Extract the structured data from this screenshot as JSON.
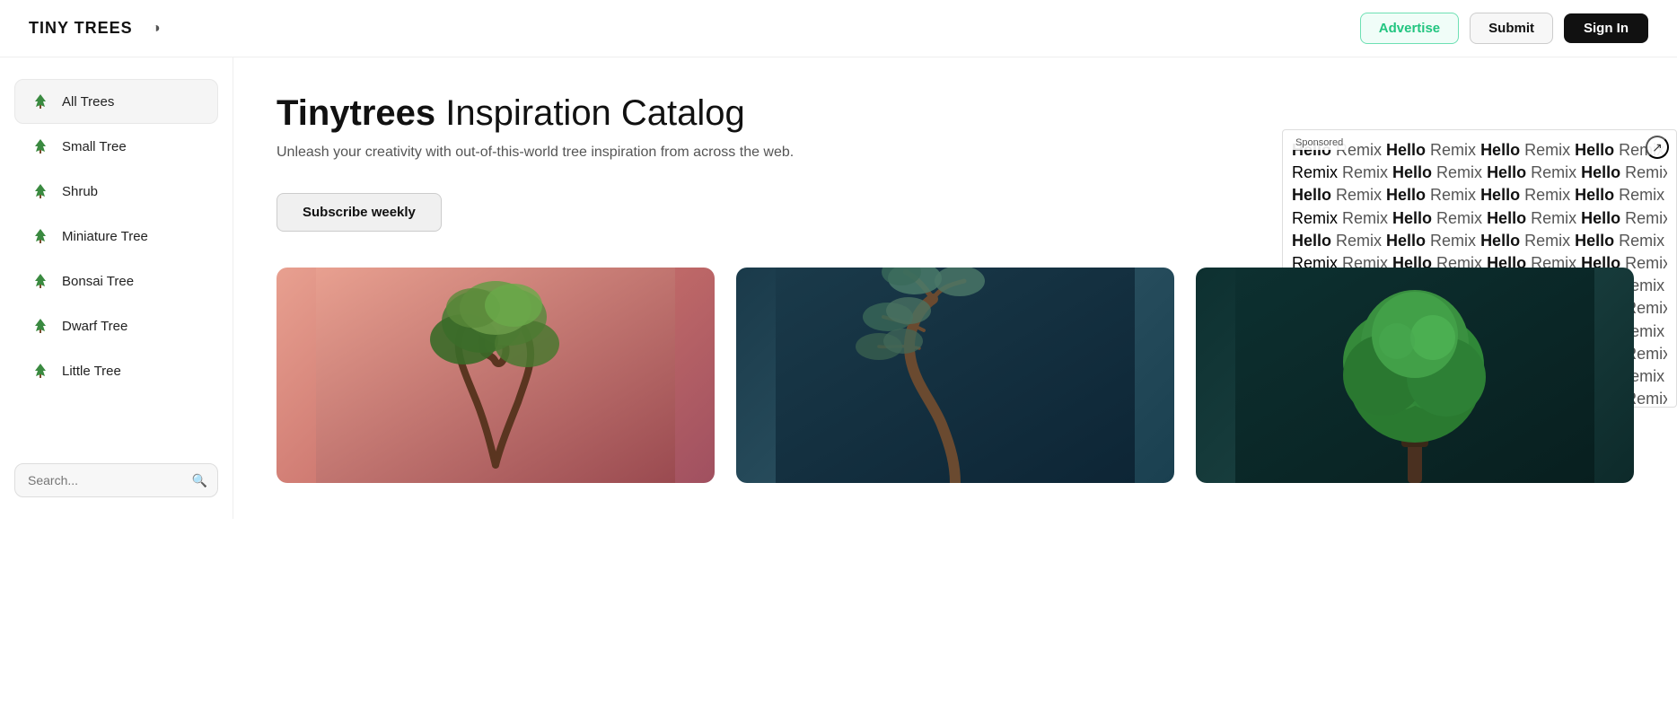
{
  "header": {
    "logo": "TINY TREES",
    "theme_toggle_icon": "◑",
    "advertise_label": "Advertise",
    "submit_label": "Submit",
    "signin_label": "Sign In"
  },
  "sidebar": {
    "items": [
      {
        "id": "all-trees",
        "label": "All Trees",
        "icon": "🌲",
        "active": true
      },
      {
        "id": "small-tree",
        "label": "Small Tree",
        "icon": "🌲",
        "active": false
      },
      {
        "id": "shrub",
        "label": "Shrub",
        "icon": "🌲",
        "active": false
      },
      {
        "id": "miniature-tree",
        "label": "Miniature Tree",
        "icon": "🌲",
        "active": false
      },
      {
        "id": "bonsai-tree",
        "label": "Bonsai Tree",
        "icon": "🌲",
        "active": false
      },
      {
        "id": "dwarf-tree",
        "label": "Dwarf Tree",
        "icon": "🌲",
        "active": false
      },
      {
        "id": "little-tree",
        "label": "Little Tree",
        "icon": "🌲",
        "active": false
      }
    ],
    "search_placeholder": "Search..."
  },
  "hero": {
    "title_bold": "Tinytrees",
    "title_regular": " Inspiration Catalog",
    "subtitle": "Unleash your creativity with out-of-this-world tree inspiration from across the web.",
    "subscribe_label": "Subscribe weekly"
  },
  "sponsored": {
    "label": "Sponsored",
    "expand_icon": "↗",
    "pattern_words": [
      "Hello",
      "Remix"
    ]
  },
  "images": [
    {
      "id": "img1",
      "alt": "Bonsai tree on pink background"
    },
    {
      "id": "img2",
      "alt": "Pine tree on dark teal background"
    },
    {
      "id": "img3",
      "alt": "Green tree on dark background"
    }
  ]
}
